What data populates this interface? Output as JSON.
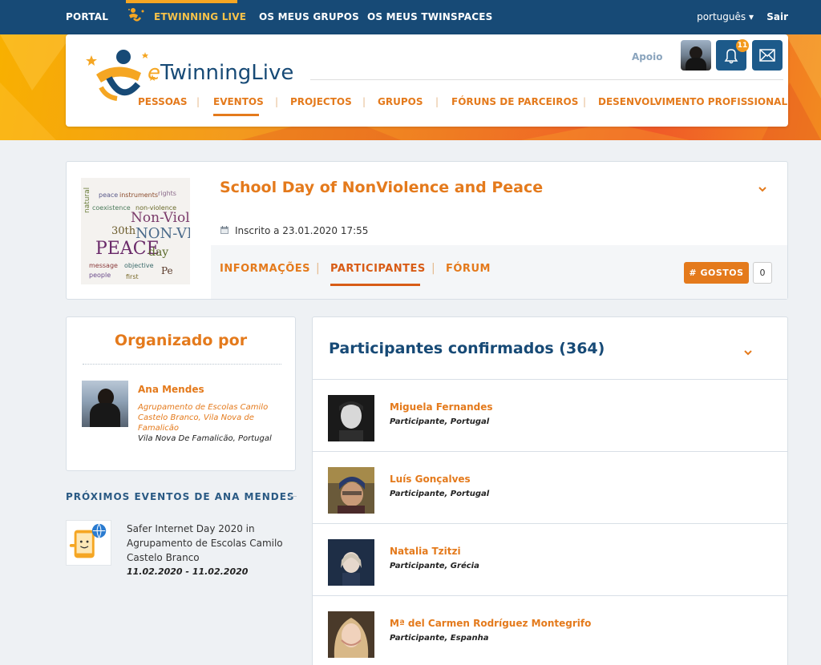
{
  "topnav": {
    "portal": "PORTAL",
    "etwinning_live": "ETWINNING LIVE",
    "meus_grupos": "OS MEUS GRUPOS",
    "meus_twinspaces": "OS MEUS TWINSPACES",
    "language": "português",
    "logout": "Sair"
  },
  "header": {
    "logo_e": "e",
    "logo_text": "TwinningLive",
    "support": "Apoio",
    "notification_count": "11",
    "nav": [
      "PESSOAS",
      "EVENTOS",
      "PROJECTOS",
      "GRUPOS",
      "FÓRUNS DE PARCEIROS",
      "DESENVOLVIMENTO PROFISSIONAL"
    ]
  },
  "event": {
    "title": "School Day of NonViolence and Peace",
    "registered": "Inscrito a  23.01.2020 17:55",
    "tabs": [
      "INFORMAÇÕES",
      "PARTICIPANTES",
      "FÓRUM"
    ],
    "likes_label": "# GOSTOS",
    "likes_count": "0"
  },
  "organizer": {
    "heading": "Organizado por",
    "name": "Ana Mendes",
    "school": "Agrupamento de Escolas Camilo Castelo Branco, Vila Nova de Famalicão",
    "location": "Vila Nova De Famalicão, Portugal"
  },
  "next_events": {
    "heading": "PRÓXIMOS EVENTOS DE ANA MENDES",
    "item_title": "Safer Internet Day 2020 in Agrupamento de Escolas Camilo Castelo Branco",
    "item_dates": "11.02.2020 - 11.02.2020"
  },
  "participants": {
    "heading": "Participantes confirmados (364)",
    "list": [
      {
        "name": "Miguela Fernandes",
        "role": "Participante, Portugal"
      },
      {
        "name": "Luís Gonçalves",
        "role": "Participante, Portugal"
      },
      {
        "name": "Natalia Tzitzi",
        "role": "Participante, Grécia"
      },
      {
        "name": "Mª del Carmen Rodríguez Montegrifo",
        "role": "Participante, Espanha"
      }
    ]
  },
  "colors": {
    "brand_blue": "#174a76",
    "accent_orange": "#e47a1c",
    "highlight_yellow": "#f5a623"
  }
}
